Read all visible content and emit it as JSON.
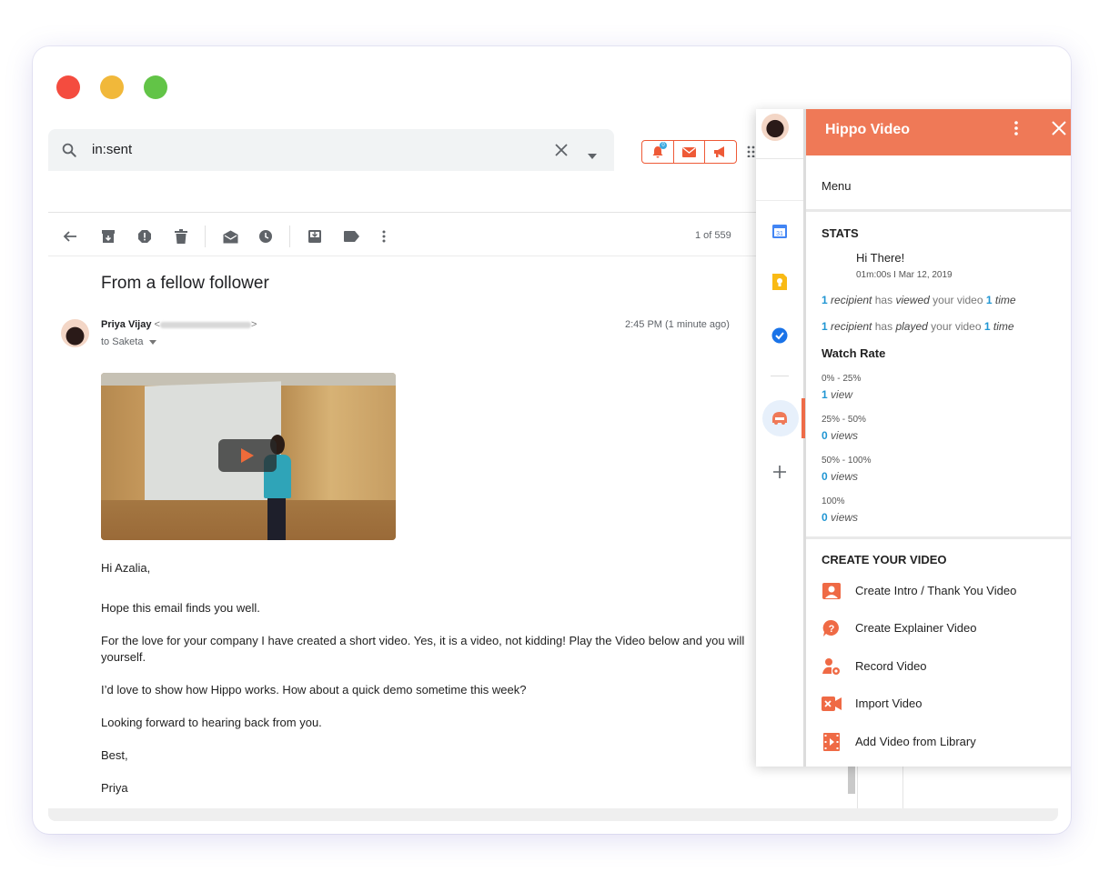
{
  "search": {
    "query": "in:sent",
    "notif_count": "0"
  },
  "toolbar": {
    "count": "1 of 559"
  },
  "email": {
    "subject": "From a fellow follower",
    "sender_name": "Priya Vijay",
    "sender_email_open": "<",
    "sender_email_close": ">",
    "to": "to Saketa",
    "time": "2:45 PM (1 minute ago)",
    "greeting": "Hi Azalia,",
    "p1": "Hope this email finds you well.",
    "p2": "For the love for your company I have created a short video. Yes, it is a video, not kidding! Play the Video below and you will",
    "p2b": "yourself.",
    "p3": "I’d love to show how Hippo works. How about a quick demo sometime this week?",
    "p4": "Looking forward to hearing back from you.",
    "p5": "Best,",
    "p6": "Priya"
  },
  "panel": {
    "title": "Hippo Video",
    "menu": "Menu",
    "stats_heading": "STATS",
    "greeting": "Hi There!",
    "meta": "01m:00s I Mar 12, 2019",
    "viewed": {
      "n1": "1",
      "w1": "recipient",
      "mid": "has",
      "verb": "viewed",
      "rest": "your video",
      "n2": "1",
      "w2": "time"
    },
    "played": {
      "n1": "1",
      "w1": "recipient",
      "mid": "has",
      "verb": "played",
      "rest": "your video",
      "n2": "1",
      "w2": "time"
    },
    "watch_rate_heading": "Watch Rate",
    "ranges": [
      {
        "label": "0% - 25%",
        "count": "1",
        "unit": "view"
      },
      {
        "label": "25% - 50%",
        "count": "0",
        "unit": "views"
      },
      {
        "label": "50% - 100%",
        "count": "0",
        "unit": "views"
      },
      {
        "label": "100%",
        "count": "0",
        "unit": "views"
      }
    ],
    "create_heading": "CREATE YOUR VIDEO",
    "create_items": [
      {
        "label": "Create Intro / Thank You Video",
        "icon": "person-card-icon"
      },
      {
        "label": "Create Explainer Video",
        "icon": "question-bubble-icon"
      },
      {
        "label": "Record Video",
        "icon": "record-person-icon"
      },
      {
        "label": "Import Video",
        "icon": "import-video-icon"
      },
      {
        "label": "Add Video from Library",
        "icon": "film-library-icon"
      }
    ],
    "calendar_day": "31"
  },
  "colors": {
    "brand": "#ef7957",
    "link_blue": "#2196d3",
    "accent_orange": "#ee5a37"
  }
}
